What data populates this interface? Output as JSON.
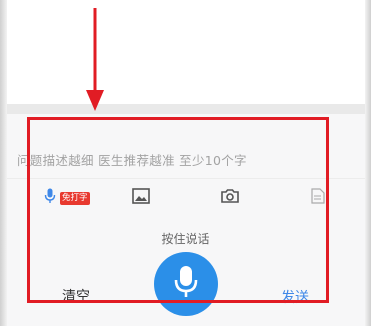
{
  "input": {
    "placeholder": "问题描述越细 医生推荐越准 至少10个字"
  },
  "toolbar": {
    "voice_badge": "免打字",
    "icons": [
      "microphone-icon",
      "image-icon",
      "camera-icon",
      "document-icon"
    ]
  },
  "voice": {
    "hint": "按住说话"
  },
  "actions": {
    "clear_label": "清空",
    "send_label": "发送"
  },
  "colors": {
    "accent": "#2b8fe8",
    "annotation": "#e11c24",
    "badge": "#e8392f",
    "send": "#3f88e8"
  }
}
